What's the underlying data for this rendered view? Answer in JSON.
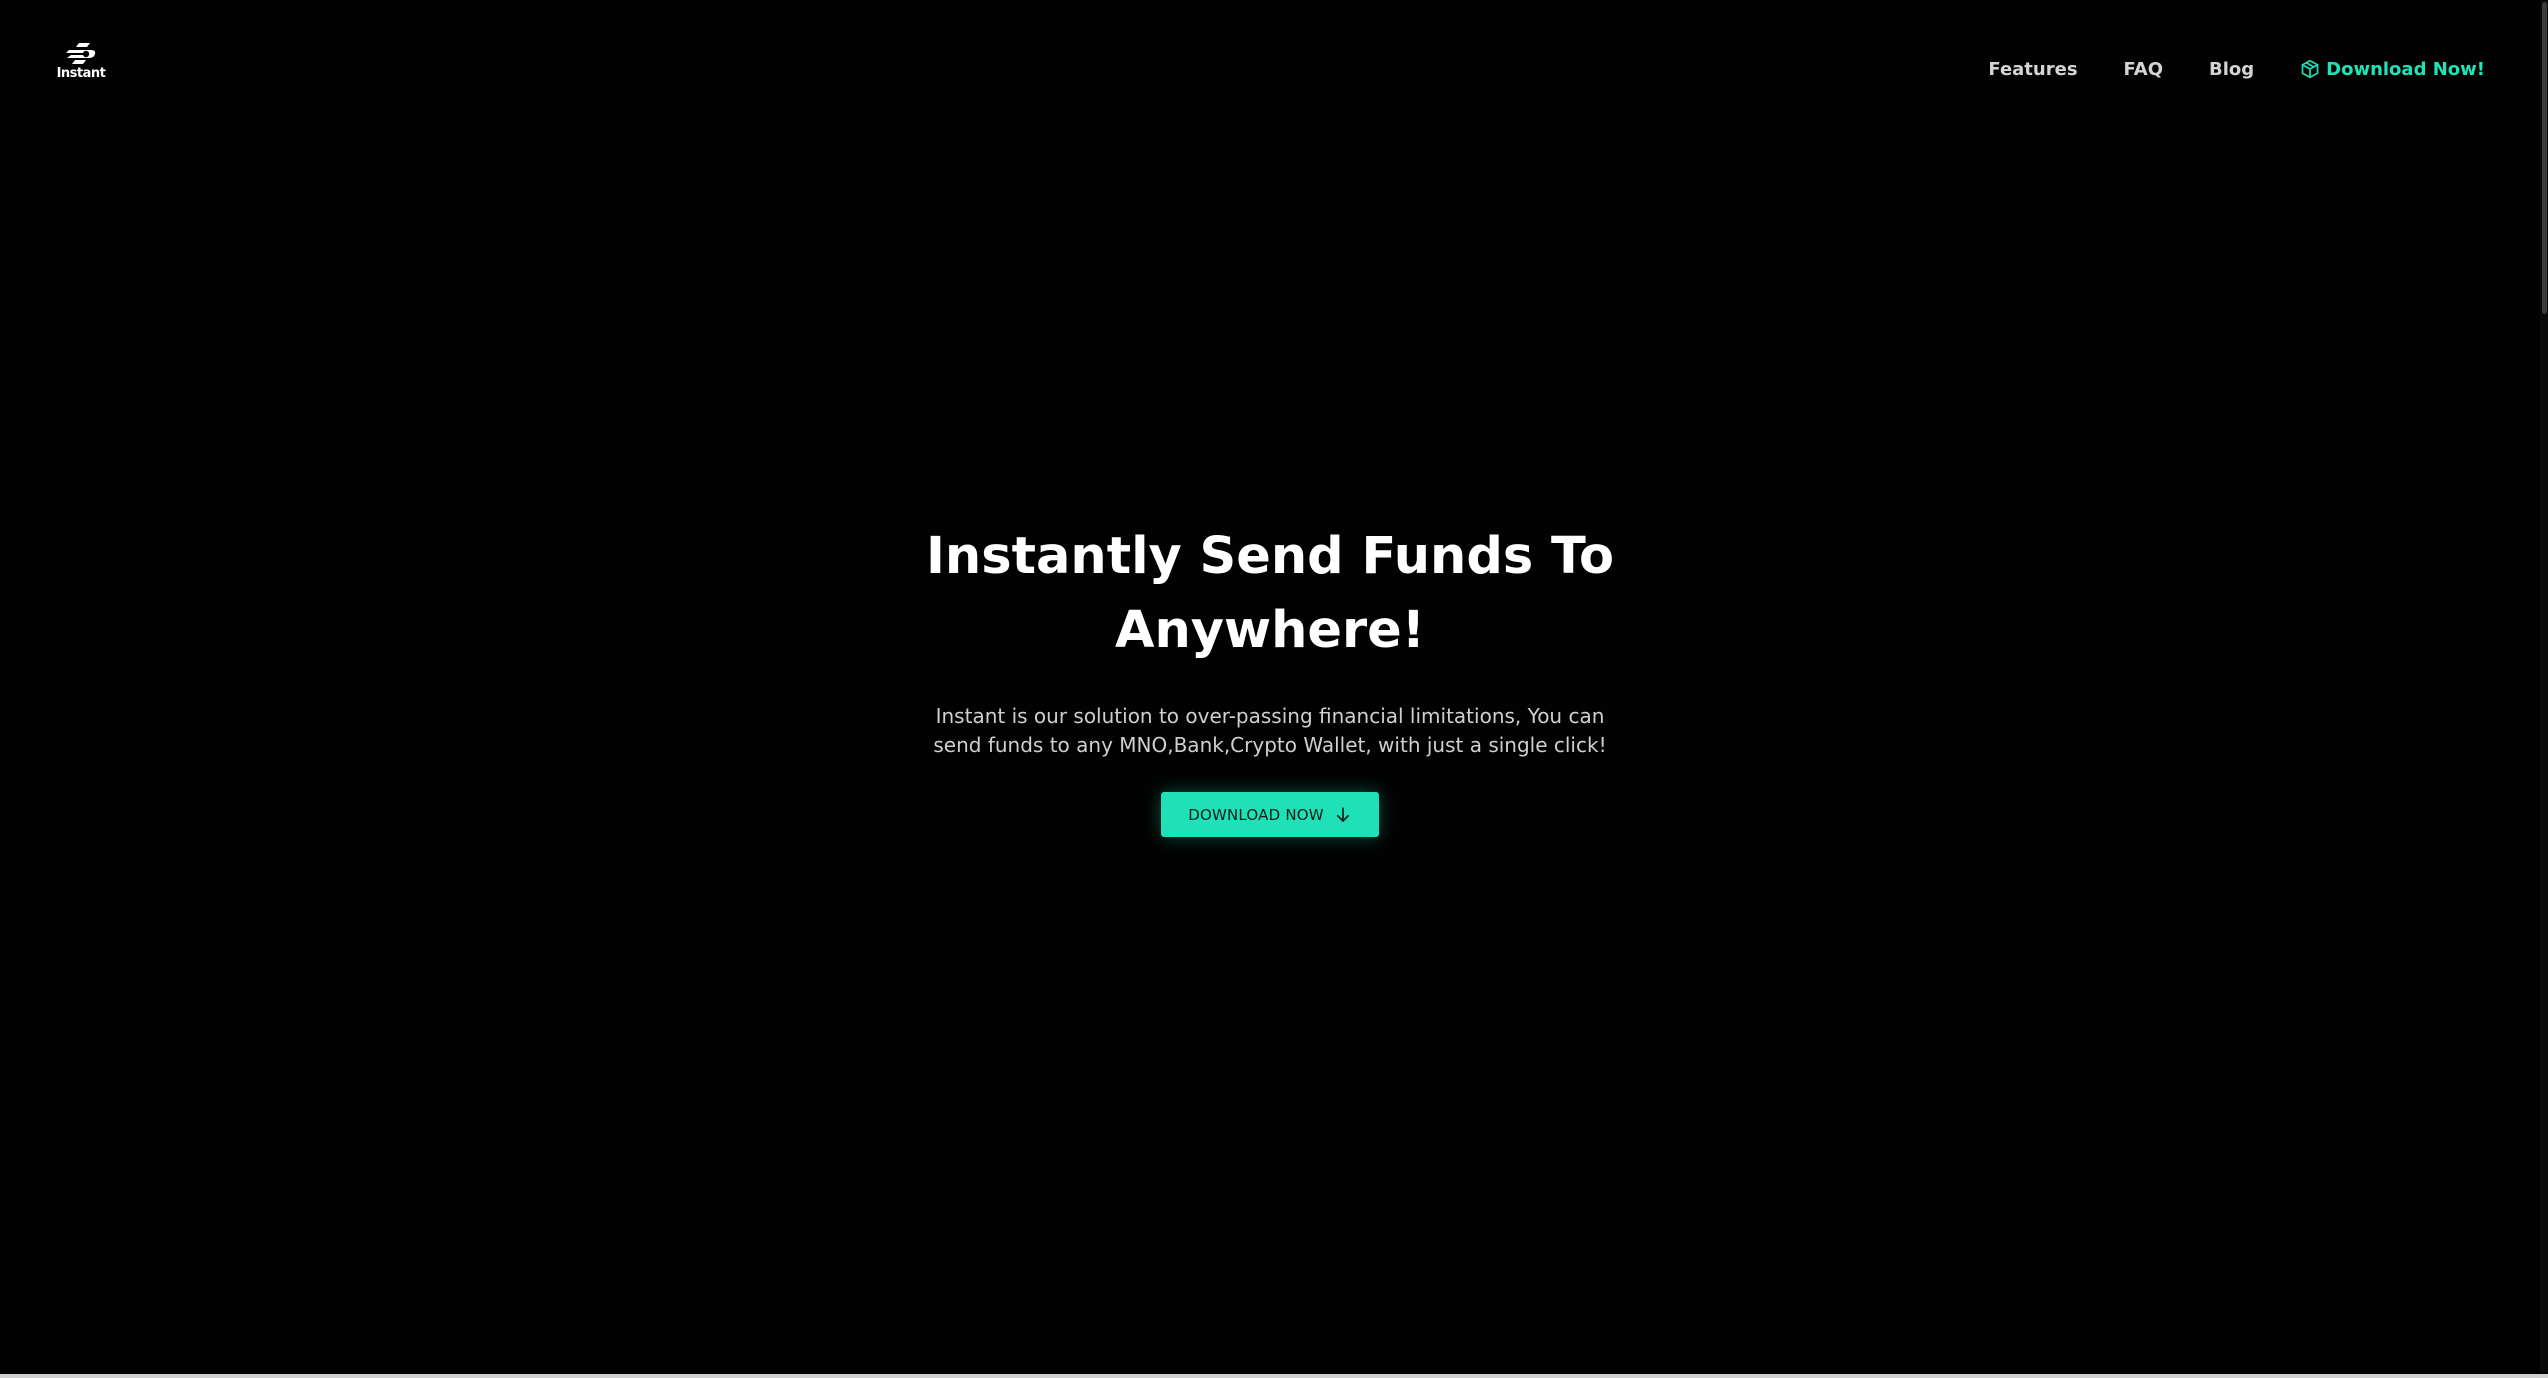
{
  "header": {
    "logo_text": "Instant",
    "nav": [
      {
        "label": "Features"
      },
      {
        "label": "FAQ"
      },
      {
        "label": "Blog"
      }
    ],
    "cta_label": "Download Now!",
    "cta_icon": "cube-icon"
  },
  "hero": {
    "title": "Instantly Send Funds To Anywhere!",
    "subtitle": "Instant is our solution to over-passing financial limitations, You can send funds to any MNO,Bank,Crypto Wallet, with just a single click!",
    "button_label": "DOWNLOAD NOW",
    "button_icon": "arrow-down-icon"
  },
  "colors": {
    "background": "#020202",
    "accent": "#1fe0b6",
    "text": "#ffffff",
    "muted_text": "#cfcfcf"
  }
}
